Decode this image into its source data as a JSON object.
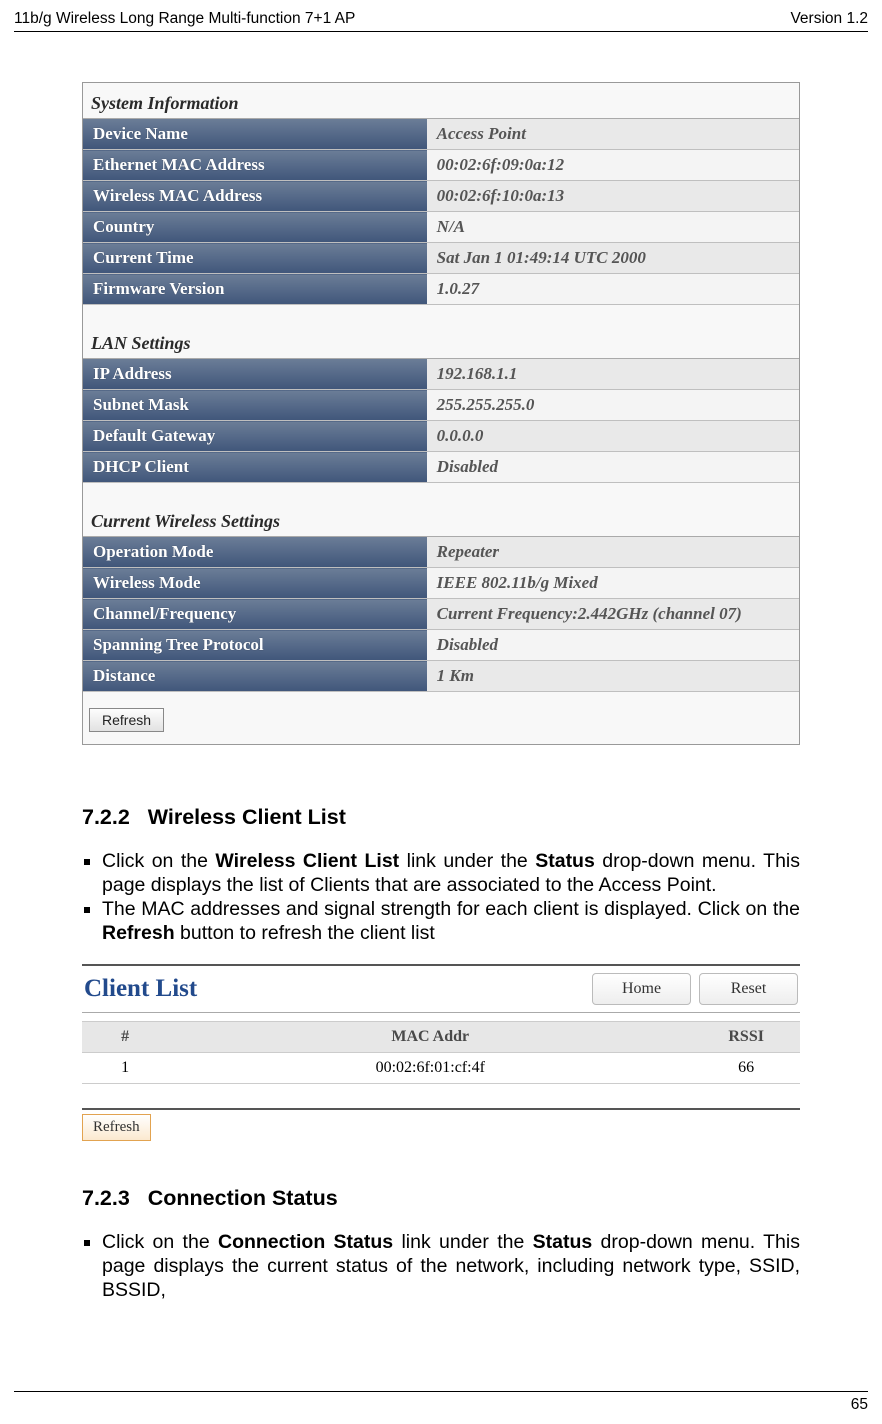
{
  "header": {
    "left": "11b/g Wireless Long Range Multi-function 7+1 AP",
    "right": "Version 1.2"
  },
  "status": {
    "systemInfo": {
      "heading": "System Information",
      "rows": [
        {
          "label": "Device Name",
          "value": "Access Point"
        },
        {
          "label": "Ethernet MAC Address",
          "value": "00:02:6f:09:0a:12"
        },
        {
          "label": "Wireless MAC Address",
          "value": "00:02:6f:10:0a:13"
        },
        {
          "label": "Country",
          "value": "N/A"
        },
        {
          "label": "Current Time",
          "value": "Sat Jan 1 01:49:14 UTC 2000"
        },
        {
          "label": "Firmware Version",
          "value": "1.0.27"
        }
      ]
    },
    "lanSettings": {
      "heading": "LAN Settings",
      "rows": [
        {
          "label": "IP Address",
          "value": "192.168.1.1"
        },
        {
          "label": "Subnet Mask",
          "value": "255.255.255.0"
        },
        {
          "label": "Default Gateway",
          "value": "0.0.0.0"
        },
        {
          "label": "DHCP Client",
          "value": "Disabled"
        }
      ]
    },
    "wirelessSettings": {
      "heading": "Current Wireless Settings",
      "rows": [
        {
          "label": "Operation Mode",
          "value": "Repeater"
        },
        {
          "label": "Wireless Mode",
          "value": "IEEE 802.11b/g Mixed"
        },
        {
          "label": "Channel/Frequency",
          "value": "Current Frequency:2.442GHz (channel 07)"
        },
        {
          "label": "Spanning Tree Protocol",
          "value": "Disabled"
        },
        {
          "label": "Distance",
          "value": "1 Km"
        }
      ]
    },
    "refresh": "Refresh"
  },
  "sec722": {
    "num": "7.2.2",
    "title": "Wireless Client List",
    "bullets": {
      "b1": {
        "t1": "Click on the ",
        "t2": "Wireless Client List",
        "t3": " link under the ",
        "t4": "Status",
        "t5": " drop-down menu. This page displays the list of Clients that are associated to the Access Point."
      },
      "b2": {
        "t1": "The MAC addresses and signal strength for each client is displayed. Click on the ",
        "t2": "Refresh",
        "t3": " button to refresh the client list"
      }
    }
  },
  "clientList": {
    "title": "Client List",
    "homeBtn": "Home",
    "resetBtn": "Reset",
    "cols": {
      "num": "#",
      "mac": "MAC Addr",
      "rssi": "RSSI"
    },
    "rows": [
      {
        "num": "1",
        "mac": "00:02:6f:01:cf:4f",
        "rssi": "66"
      }
    ],
    "refresh": "Refresh"
  },
  "sec723": {
    "num": "7.2.3",
    "title": "Connection Status",
    "bullets": {
      "b1": {
        "t1": "Click on the ",
        "t2": "Connection Status",
        "t3": " link under the ",
        "t4": "Status",
        "t5": " drop-down menu. This page displays the current status of the network, including network type, SSID,  BSSID,"
      }
    }
  },
  "footer": {
    "page": "65"
  }
}
